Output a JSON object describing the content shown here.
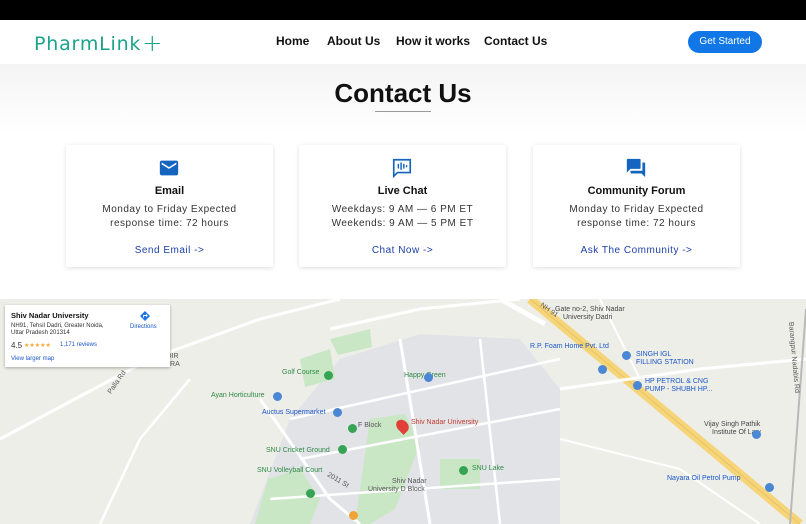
{
  "brand": {
    "name": "PharmLink",
    "plus": "+"
  },
  "nav": {
    "items": [
      {
        "label": "Home"
      },
      {
        "label": "About Us"
      },
      {
        "label": "How it works"
      },
      {
        "label": "Contact Us"
      }
    ],
    "cta": "Get Started"
  },
  "page": {
    "title": "Contact Us"
  },
  "cards": [
    {
      "icon": "mail-icon",
      "heading": "Email",
      "lines": [
        "Monday to Friday Expected",
        "response time: 72 hours"
      ],
      "link": "Send Email ->"
    },
    {
      "icon": "chat-icon",
      "heading": "Live Chat",
      "lines": [
        "Weekdays: 9 AM — 6 PM ET",
        "Weekends: 9 AM — 5 PM ET"
      ],
      "link": "Chat Now ->"
    },
    {
      "icon": "forum-icon",
      "heading": "Community Forum",
      "lines": [
        "Monday to Friday Expected",
        "response time: 72 hours"
      ],
      "link": "Ask The Community ->"
    }
  ],
  "map": {
    "info": {
      "name": "Shiv Nadar University",
      "address_line1": "NH91, Tehsil Dadri, Greater Noida,",
      "address_line2": "Uttar Pradesh 201314",
      "rating": "4.5",
      "stars": "★★★★★",
      "reviews": "1,171 reviews",
      "larger_map": "View larger map",
      "directions": "Directions"
    },
    "labels": {
      "gate": "Gate no-2, Shiv Nadar",
      "gate2": "University Dadri",
      "foam": "R.P. Foam Home Pvt. Ltd",
      "singh": "SINGH IGL",
      "singh2": "FILLING STATION",
      "hp": "HP PETROL & CNG",
      "hp2": "PUMP - SHUBH HP...",
      "vijay": "Vijay Singh Pathik",
      "vijay2": "Institute Of Law",
      "nayara": "Nayara Oil Petrol Pump",
      "mandir": "C MANDIR",
      "mandir2": "CHITHARA",
      "golf": "Golf Course",
      "happy": "Happy Green",
      "ayan": "Ayan Horticulture",
      "auctus": "Auctus Supermarket",
      "fblock": "F Block",
      "snu": "Shiv Nadar University",
      "cricket": "SNU Cricket Ground",
      "volley": "SNU Volleyball Court",
      "lake": "SNU Lake",
      "dblock": "Shiv Nadar",
      "dblock2": "University D Block",
      "road": "Palla Rd",
      "nh": "NH 91",
      "right_road": "Barangpur Nadabis Rd",
      "street": "2011 St"
    }
  },
  "colors": {
    "brand": "#1aa38a",
    "accent": "#1277e6",
    "link": "#1c3fa8",
    "highway": "#f6d57a",
    "green": "#c9e7c5",
    "pin": "#e04038"
  }
}
